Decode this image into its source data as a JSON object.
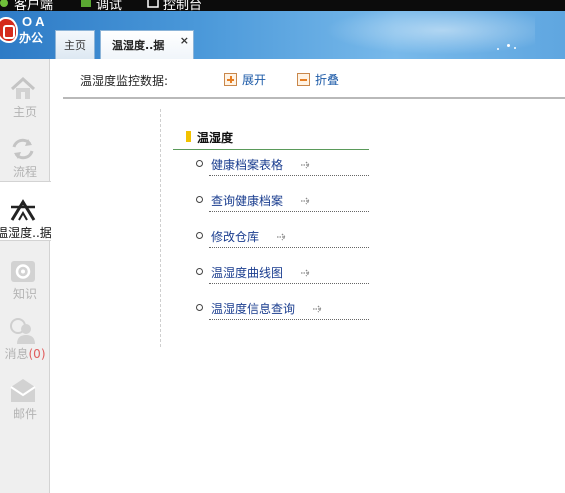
{
  "menubar": {
    "items": [
      {
        "label": "客户端",
        "icon": "client-icon"
      },
      {
        "label": "调试",
        "icon": "debug-icon"
      },
      {
        "label": "控制台",
        "icon": "console-icon"
      }
    ]
  },
  "header": {
    "logo_text": "OA",
    "logo_subtext": "办公"
  },
  "tabs": [
    {
      "label": "主页",
      "active": false
    },
    {
      "label": "温湿度..据",
      "active": true,
      "close_label": "×"
    }
  ],
  "sidebar": {
    "items": [
      {
        "label": "主页",
        "icon": "home-icon"
      },
      {
        "label": "流程",
        "icon": "workflow-icon"
      },
      {
        "label": "温湿度..据",
        "icon": "tent-icon",
        "active": true
      },
      {
        "label": "知识",
        "icon": "knowledge-icon"
      },
      {
        "label": "消息",
        "count": "(0)",
        "icon": "message-icon"
      },
      {
        "label": "邮件",
        "icon": "mail-icon"
      }
    ]
  },
  "main": {
    "title": "温湿度监控数据:",
    "expand_label": "展开",
    "collapse_label": "折叠",
    "group_title": "温湿度",
    "links": [
      {
        "label": "健康档案表格"
      },
      {
        "label": "查询健康档案"
      },
      {
        "label": "修改仓库"
      },
      {
        "label": "温湿度曲线图"
      },
      {
        "label": "温湿度信息查询"
      }
    ]
  },
  "colors": {
    "header_blue": "#4a98d9",
    "link_blue": "#1a3d8f",
    "accent_orange": "#e67e22",
    "group_marker": "#f2c200",
    "group_underline": "#5a9a5a"
  }
}
